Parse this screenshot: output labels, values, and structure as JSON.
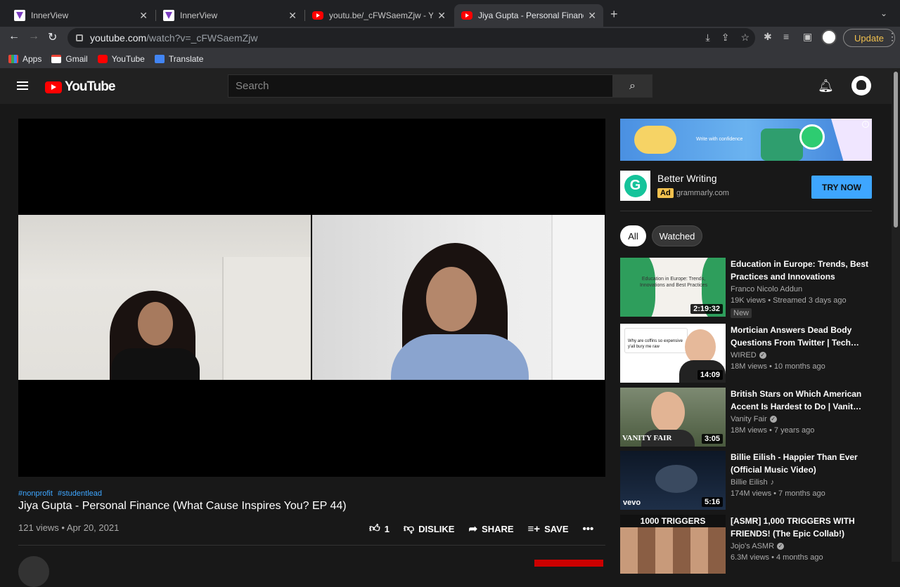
{
  "browser": {
    "tabs": [
      {
        "title": "InnerView"
      },
      {
        "title": "InnerView"
      },
      {
        "title": "youtu.be/_cFWSaemZjw - YouT"
      },
      {
        "title": "Jiya Gupta - Personal Finance ("
      }
    ],
    "url_host": "youtube.com",
    "url_path": "/watch?v=_cFWSaemZjw",
    "update_label": "Update",
    "bookmarks": [
      "Apps",
      "Gmail",
      "YouTube",
      "Translate"
    ]
  },
  "youtube": {
    "logo_text": "YouTube",
    "search_placeholder": "Search"
  },
  "video": {
    "tags": [
      "#nonprofit",
      "#studentlead"
    ],
    "title": "Jiya Gupta - Personal Finance (What Cause Inspires You? EP 44)",
    "meta": "121 views • Apr 20, 2021",
    "like_count": "1",
    "dislike_label": "DISLIKE",
    "share_label": "SHARE",
    "save_label": "SAVE"
  },
  "ad": {
    "banner_text": "Write with confidence",
    "title": "Better Writing",
    "badge": "Ad",
    "domain": "grammarly.com",
    "cta": "TRY NOW"
  },
  "chips": [
    "All",
    "Watched"
  ],
  "recommendations": [
    {
      "title": "Education in Europe: Trends, Best Practices and Innovations",
      "channel": "Franco Nicolo Addun",
      "verified": false,
      "meta": "19K views • Streamed 3 days ago",
      "badge": "New",
      "duration": "2:19:32",
      "thumb_text": "Education in Europe: Trends, Innovations and Best Practices"
    },
    {
      "title": "Mortician Answers Dead Body Questions From Twitter | Tech…",
      "channel": "WIRED",
      "verified": true,
      "meta": "18M views • 10 months ago",
      "duration": "14:09",
      "thumb_text": "Why are coffins so expensive y'all bury me raw"
    },
    {
      "title": "British Stars on Which American Accent Is Hardest to Do | Vanit…",
      "channel": "Vanity Fair",
      "verified": true,
      "meta": "18M views • 7 years ago",
      "duration": "3:05",
      "thumb_text": "VANITY FAIR"
    },
    {
      "title": "Billie Eilish - Happier Than Ever (Official Music Video)",
      "channel": "Billie Eilish",
      "music": true,
      "meta": "174M views • 7 months ago",
      "duration": "5:16",
      "thumb_text": "vevo"
    },
    {
      "title": "[ASMR] 1,000 TRIGGERS WITH FRIENDS! (The Epic Collab!)",
      "channel": "Jojo's ASMR",
      "verified": true,
      "meta": "6.3M views • 4 months ago",
      "thumb_text": "1000 TRIGGERS"
    }
  ]
}
